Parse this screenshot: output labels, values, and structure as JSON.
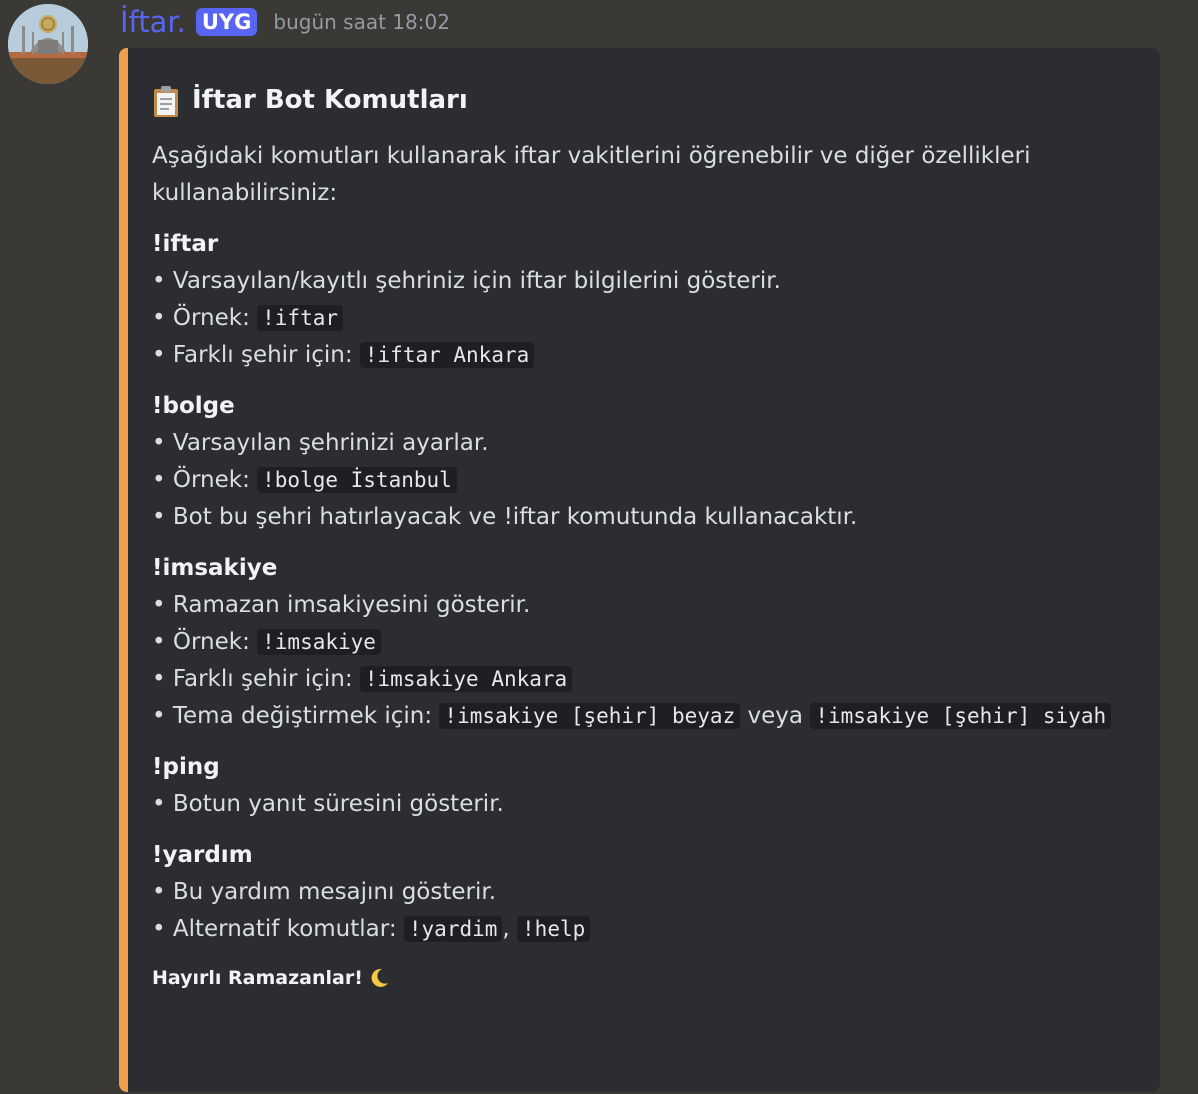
{
  "message": {
    "username": "İftar.",
    "tag": "UYG",
    "timestamp": "bugün saat 18:02"
  },
  "embed": {
    "accent_color": "#f0a04b",
    "title_icon": "clipboard-icon",
    "title": "İftar Bot Komutları",
    "intro": "Aşağıdaki komutları kullanarak iftar vakitlerini öğrenebilir ve diğer özellikleri kullanabilirsiniz:",
    "commands": {
      "iftar": {
        "name": "!iftar",
        "l1": "• Varsayılan/kayıtlı şehriniz için iftar bilgilerini gösterir.",
        "l2_prefix": "• Örnek: ",
        "l2_code": "!iftar",
        "l3_prefix": "• Farklı şehir için: ",
        "l3_code": "!iftar Ankara"
      },
      "bolge": {
        "name": "!bolge",
        "l1": "• Varsayılan şehrinizi ayarlar.",
        "l2_prefix": "• Örnek: ",
        "l2_code": "!bolge İstanbul",
        "l3": "• Bot bu şehri hatırlayacak ve !iftar komutunda kullanacaktır."
      },
      "imsakiye": {
        "name": "!imsakiye",
        "l1": "• Ramazan imsakiyesini gösterir.",
        "l2_prefix": "• Örnek: ",
        "l2_code": "!imsakiye",
        "l3_prefix": "• Farklı şehir için: ",
        "l3_code": "!imsakiye Ankara",
        "l4_prefix": "• Tema değiştirmek için: ",
        "l4_code1": "!imsakiye [şehir] beyaz",
        "l4_mid": " veya ",
        "l4_code2": "!imsakiye [şehir] siyah"
      },
      "ping": {
        "name": "!ping",
        "l1": "• Botun yanıt süresini gösterir."
      },
      "yardim": {
        "name": "!yardım",
        "l1": "• Bu yardım mesajını gösterir.",
        "l2_prefix": "• Alternatif komutlar: ",
        "l2_code1": "!yardim",
        "l2_sep": ", ",
        "l2_code2": "!help"
      }
    },
    "footer": "Hayırlı Ramazanlar!",
    "footer_icon": "crescent-moon-icon"
  }
}
